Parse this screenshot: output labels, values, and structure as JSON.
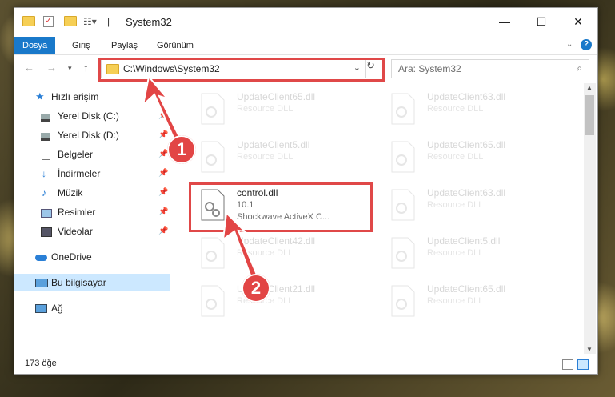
{
  "window": {
    "title": "System32"
  },
  "ribbon": {
    "tabs": [
      "Dosya",
      "Giriş",
      "Paylaş",
      "Görünüm"
    ]
  },
  "address": {
    "path": "C:\\Windows\\System32"
  },
  "search": {
    "placeholder": "Ara: System32"
  },
  "sidebar": {
    "items": [
      {
        "label": "Hızlı erişim",
        "icon": "star-icon"
      },
      {
        "label": "Yerel Disk (C:)",
        "icon": "drive-icon"
      },
      {
        "label": "Yerel Disk (D:)",
        "icon": "drive-icon"
      },
      {
        "label": "Belgeler",
        "icon": "documents-icon"
      },
      {
        "label": "İndirmeler",
        "icon": "download-icon"
      },
      {
        "label": "Müzik",
        "icon": "music-icon"
      },
      {
        "label": "Resimler",
        "icon": "pictures-icon"
      },
      {
        "label": "Videolar",
        "icon": "video-icon"
      },
      {
        "label": "OneDrive",
        "icon": "cloud-icon"
      },
      {
        "label": "Bu bilgisayar",
        "icon": "computer-icon"
      },
      {
        "label": "Ağ",
        "icon": "network-icon"
      }
    ]
  },
  "files": {
    "left": [
      {
        "name": "UpdateClient65.dll",
        "desc": "Resource DLL"
      },
      {
        "name": "UpdateClient5.dll",
        "desc": "Resource DLL"
      },
      {
        "name": "control.dll",
        "version": "10.1",
        "desc": "Shockwave ActiveX C..."
      },
      {
        "name": "UpdateClient42.dll",
        "desc": "Resource DLL"
      },
      {
        "name": "UpdateClient21.dll",
        "desc": "Resource DLL"
      }
    ],
    "right": [
      {
        "name": "UpdateClient63.dll",
        "desc": "Resource DLL"
      },
      {
        "name": "UpdateClient65.dll",
        "desc": "Resource DLL"
      },
      {
        "name": "UpdateClient63.dll",
        "desc": "Resource DLL"
      },
      {
        "name": "UpdateClient5.dll",
        "desc": "Resource DLL"
      },
      {
        "name": "UpdateClient65.dll",
        "desc": "Resource DLL"
      }
    ]
  },
  "status": {
    "count": "173 öğe"
  },
  "annotations": {
    "step1": "1",
    "step2": "2",
    "color": "#e04848"
  }
}
